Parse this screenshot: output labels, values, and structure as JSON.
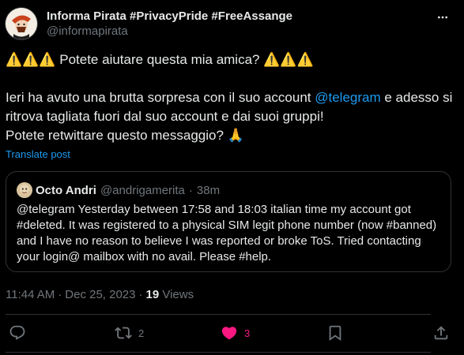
{
  "author": {
    "name": "Informa Pirata #PrivacyPride #FreeAssange",
    "handle": "@informapirata"
  },
  "post": {
    "line1_prefix": "⚠️⚠️⚠️",
    "line1_text": " Potete aiutare questa mia amica? ",
    "line1_suffix": "⚠️⚠️⚠️",
    "line2_a": "Ieri ha avuto una brutta sorpresa con il suo account ",
    "line2_mention": "@telegram",
    "line2_b": " e adesso si ritrova tagliata fuori dal suo account e dai suoi gruppi!",
    "line3_text": "Potete retwittare questo messaggio? ",
    "line3_emoji": "🙏"
  },
  "translate_label": "Translate post",
  "quoted": {
    "name": "Octo Andri",
    "handle": "@andrigamerita",
    "separator": "·",
    "time": "38m",
    "text": "@telegram Yesterday between 17:58 and 18:03 italian time my account got #deleted. It was registered to a physical SIM legit phone number (now #banned) and I have no reason to believe I was reported or broke ToS. Tried contacting your login@ mailbox with no avail. Please #help."
  },
  "meta": {
    "time": "11:44 AM",
    "separator": "·",
    "date": "Dec 25, 2023",
    "views_count": "19",
    "views_label": "Views"
  },
  "actions": {
    "reply_count": "",
    "repost_count": "2",
    "like_count": "3"
  },
  "colors": {
    "accent": "#1d9bf0",
    "like": "#f91880",
    "muted": "#71767b"
  }
}
